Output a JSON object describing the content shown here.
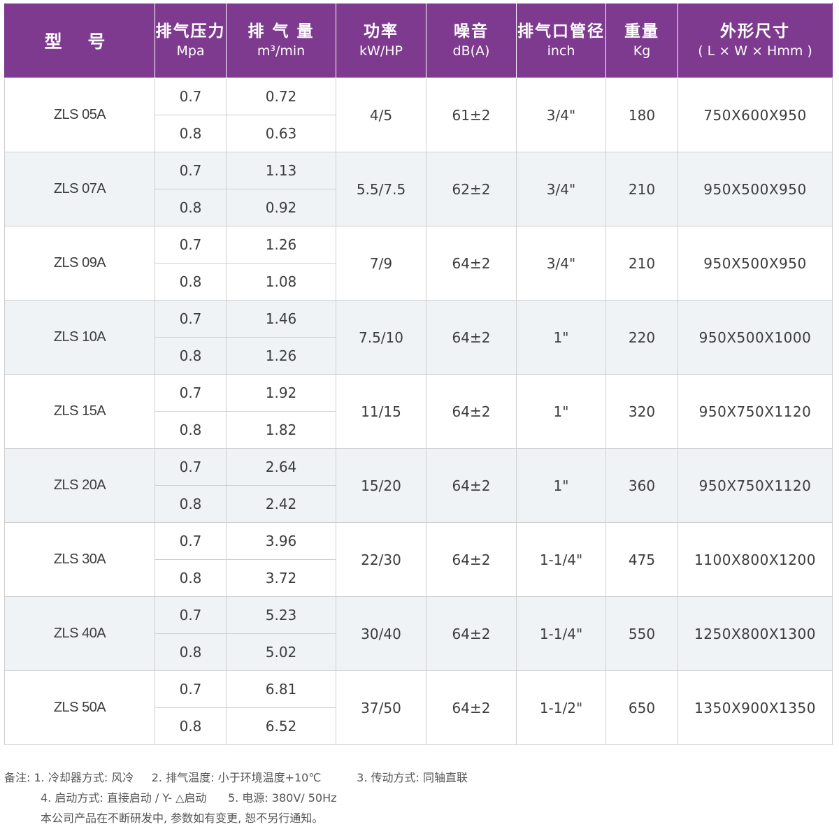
{
  "headers": [
    {
      "main": "型 号",
      "sub": ""
    },
    {
      "main": "排气压力",
      "sub": "Mpa"
    },
    {
      "main": "排 气 量",
      "sub": "m³/min"
    },
    {
      "main": "功率",
      "sub": "kW/HP"
    },
    {
      "main": "噪音",
      "sub": "dB(A)"
    },
    {
      "main": "排气口管径",
      "sub": "inch"
    },
    {
      "main": "重量",
      "sub": "Kg"
    },
    {
      "main": "外形尺寸",
      "sub": "( L × W × Hmm )"
    }
  ],
  "rows": [
    {
      "model": "ZLS 05A",
      "p1": "0.7",
      "q1": "0.72",
      "p2": "0.8",
      "q2": "0.63",
      "power": "4/5",
      "noise": "61±2",
      "pipe": "3/4\"",
      "weight": "180",
      "dims": "750X600X950"
    },
    {
      "model": "ZLS 07A",
      "p1": "0.7",
      "q1": "1.13",
      "p2": "0.8",
      "q2": "0.92",
      "power": "5.5/7.5",
      "noise": "62±2",
      "pipe": "3/4\"",
      "weight": "210",
      "dims": "950X500X950"
    },
    {
      "model": "ZLS 09A",
      "p1": "0.7",
      "q1": "1.26",
      "p2": "0.8",
      "q2": "1.08",
      "power": "7/9",
      "noise": "64±2",
      "pipe": "3/4\"",
      "weight": "210",
      "dims": "950X500X950"
    },
    {
      "model": "ZLS 10A",
      "p1": "0.7",
      "q1": "1.46",
      "p2": "0.8",
      "q2": "1.26",
      "power": "7.5/10",
      "noise": "64±2",
      "pipe": "1\"",
      "weight": "220",
      "dims": "950X500X1000"
    },
    {
      "model": "ZLS 15A",
      "p1": "0.7",
      "q1": "1.92",
      "p2": "0.8",
      "q2": "1.82",
      "power": "11/15",
      "noise": "64±2",
      "pipe": "1\"",
      "weight": "320",
      "dims": "950X750X1120"
    },
    {
      "model": "ZLS 20A",
      "p1": "0.7",
      "q1": "2.64",
      "p2": "0.8",
      "q2": "2.42",
      "power": "15/20",
      "noise": "64±2",
      "pipe": "1\"",
      "weight": "360",
      "dims": "950X750X1120"
    },
    {
      "model": "ZLS 30A",
      "p1": "0.7",
      "q1": "3.96",
      "p2": "0.8",
      "q2": "3.72",
      "power": "22/30",
      "noise": "64±2",
      "pipe": "1-1/4\"",
      "weight": "475",
      "dims": "1100X800X1200"
    },
    {
      "model": "ZLS 40A",
      "p1": "0.7",
      "q1": "5.23",
      "p2": "0.8",
      "q2": "5.02",
      "power": "30/40",
      "noise": "64±2",
      "pipe": "1-1/4\"",
      "weight": "550",
      "dims": "1250X800X1300"
    },
    {
      "model": "ZLS 50A",
      "p1": "0.7",
      "q1": "6.81",
      "p2": "0.8",
      "q2": "6.52",
      "power": "37/50",
      "noise": "64±2",
      "pipe": "1-1/2\"",
      "weight": "650",
      "dims": "1350X900X1350"
    }
  ],
  "notes": {
    "line1": "备注: 1. 冷却器方式: 风冷     2. 排气温度: 小于环境温度+10℃          3. 传动方式: 同轴直联",
    "line2": "4. 启动方式: 直接启动 / Y- △启动      5. 电源: 380V/ 50Hz",
    "line3": "本公司产品在不断研发中, 参数如有变更, 恕不另行通知。"
  },
  "colors": {
    "header_bg": "#7d3a8e",
    "shade_row": "#eff3f6"
  }
}
